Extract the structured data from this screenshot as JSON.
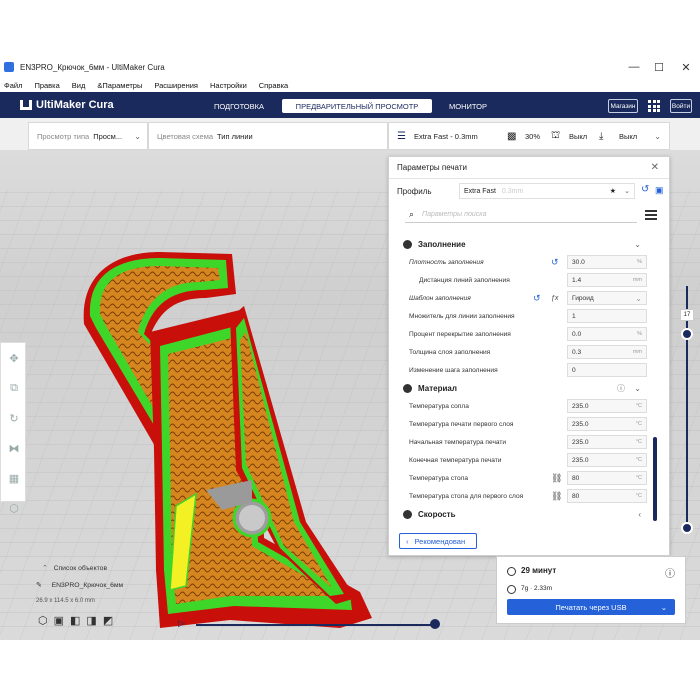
{
  "window": {
    "title": "EN3PRO_Крючок_6мм - UltiMaker Cura",
    "minimize": "—",
    "maximize": "☐",
    "close": "✕"
  },
  "menu": [
    "Файл",
    "Правка",
    "Вид",
    "&Параметры",
    "Расширения",
    "Настройки",
    "Справка"
  ],
  "header": {
    "logo": "UltiMaker Cura",
    "stages": [
      "ПОДГОТОВКА",
      "ПРЕДВАРИТЕЛЬНЫЙ ПРОСМОТР",
      "МОНИТОР"
    ],
    "active_stage": "ПРЕДВАРИТЕЛЬНЫЙ ПРОСМОТР",
    "marketplace": "Магазин",
    "signin": "Войти"
  },
  "toolbar": {
    "view_type_label": "Просмотр типа",
    "view_type_value": "Просм...",
    "color_scheme_label": "Цветовая схема",
    "color_scheme_value": "Тип линии",
    "profile": "Extra Fast - 0.3mm",
    "infill": "30%",
    "support": "Выкл",
    "adhesion": "Выкл"
  },
  "panel": {
    "title": "Параметры печати",
    "profile_label": "Профиль",
    "profile_value": "Extra Fast",
    "profile_hint": "0.3mm",
    "search_placeholder": "Параметры поиска",
    "infill_category": "Заполнение",
    "material_category": "Материал",
    "speed_category": "Скорость",
    "rows": [
      {
        "name": "Плотность заполнения",
        "value": "30.0",
        "unit": "%"
      },
      {
        "name": "Дистанция линий заполнения",
        "value": "1.4",
        "unit": "mm"
      },
      {
        "name": "Шаблон заполнения",
        "value": "Гироид",
        "unit": ""
      },
      {
        "name": "Множитель для линии заполнения",
        "value": "1",
        "unit": ""
      },
      {
        "name": "Процент перекрытие заполнения",
        "value": "0.0",
        "unit": "%"
      },
      {
        "name": "Толщина слоя заполнения",
        "value": "0.3",
        "unit": "mm"
      },
      {
        "name": "Изменение шага заполнения",
        "value": "0",
        "unit": ""
      },
      {
        "name": "Температура сопла",
        "value": "235.0",
        "unit": "°C"
      },
      {
        "name": "Температура печати первого слоя",
        "value": "235.0",
        "unit": "°C"
      },
      {
        "name": "Начальная температура печати",
        "value": "235.0",
        "unit": "°C"
      },
      {
        "name": "Конечная температура печати",
        "value": "235.0",
        "unit": "°C"
      },
      {
        "name": "Температура стола",
        "value": "80",
        "unit": "°C"
      },
      {
        "name": "Температура стола для первого слоя",
        "value": "80",
        "unit": "°C"
      }
    ],
    "recommended_button": "Рекомендован"
  },
  "layer": {
    "current": "17"
  },
  "print_info": {
    "time": "29 минут",
    "material": "7g · 2.33m",
    "print_button": "Печатать через USB"
  },
  "objects": {
    "title": "Список объектов",
    "name": "EN3PRO_Крючок_6мм",
    "dims": "26.9 x 114.5 x 6.0 mm"
  },
  "colors": {
    "header_bg": "#1b2a5c",
    "accent": "#2561d8",
    "wall_red": "#e5140e",
    "infill_orange": "#d87a1a",
    "inner_green": "#3fd62a",
    "skin_yellow": "#f3f023"
  }
}
